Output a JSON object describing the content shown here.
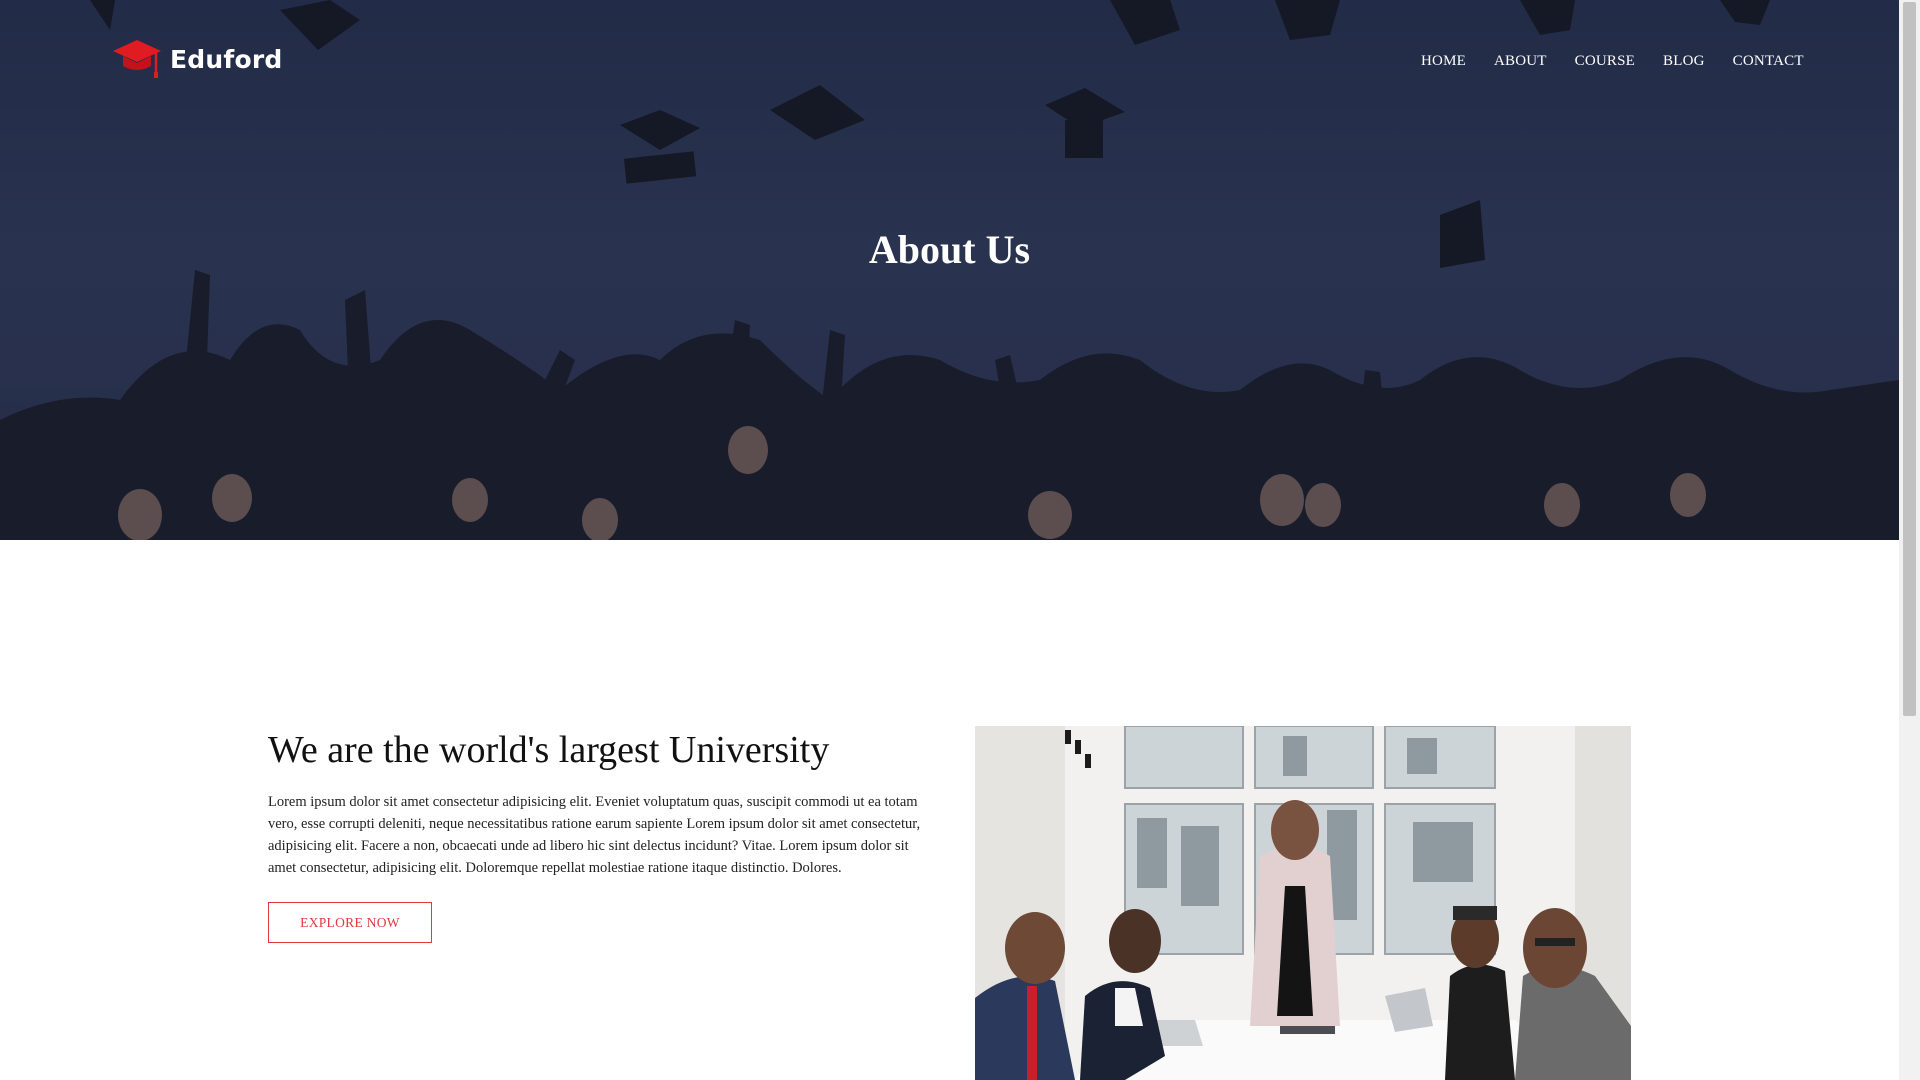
{
  "brand": {
    "name": "Eduford",
    "logo_icon": "graduation-cap-icon",
    "accent": "#e0393f"
  },
  "nav": {
    "items": [
      {
        "label": "HOME"
      },
      {
        "label": "ABOUT"
      },
      {
        "label": "COURSE"
      },
      {
        "label": "BLOG"
      },
      {
        "label": "CONTACT"
      }
    ]
  },
  "hero": {
    "title": "About Us"
  },
  "about": {
    "heading": "We are the world's largest University",
    "text": "Lorem ipsum dolor sit amet consectetur adipisicing elit. Eveniet voluptatum quas, suscipit commodi ut ea totam vero, esse corrupti deleniti, neque necessitatibus ratione earum sapiente Lorem ipsum dolor sit amet consectetur, adipisicing elit. Facere a non, obcaecati unde ad libero hic sint delectus incidunt? Vitae. Lorem ipsum dolor sit amet consectetur, adipisicing elit. Doloremque repellat molestiae ratione itaque distinctio. Dolores.",
    "button_label": "EXPLORE NOW"
  }
}
